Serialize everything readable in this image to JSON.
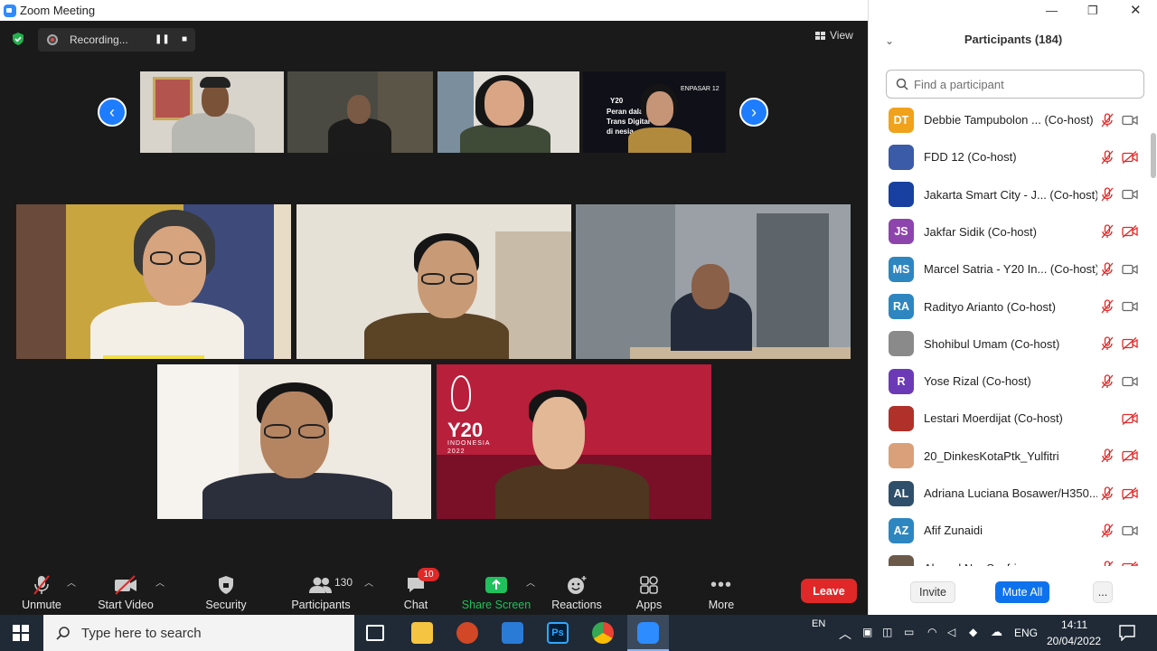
{
  "window": {
    "title": "Zoom Meeting"
  },
  "stage": {
    "recording_label": "Recording...",
    "view_label": "View"
  },
  "toolbar": {
    "unmute": "Unmute",
    "start_video": "Start Video",
    "security": "Security",
    "participants": "Participants",
    "participants_count": "130",
    "chat": "Chat",
    "chat_badge": "10",
    "share_screen": "Share Screen",
    "reactions": "Reactions",
    "apps": "Apps",
    "more": "More",
    "leave": "Leave"
  },
  "panel": {
    "title": "Participants (184)",
    "search_placeholder": "Find a participant",
    "invite": "Invite",
    "mute_all": "Mute All",
    "more": "...",
    "participants": [
      {
        "initials": "DT",
        "name": "Debbie Tampubolon ...  (Co-host)",
        "color": "#f0a21c",
        "mic_muted": true,
        "cam_off": false
      },
      {
        "initials": "",
        "name": "FDD 12 (Co-host)",
        "color": "#3b5aa8",
        "mic_muted": true,
        "cam_off": true
      },
      {
        "initials": "",
        "name": "Jakarta Smart City - J...  (Co-host)",
        "color": "#1740a0",
        "mic_muted": true,
        "cam_off": false
      },
      {
        "initials": "JS",
        "name": "Jakfar Sidik (Co-host)",
        "color": "#8e44ad",
        "mic_muted": true,
        "cam_off": true
      },
      {
        "initials": "MS",
        "name": "Marcel Satria - Y20 In...  (Co-host)",
        "color": "#2e86c1",
        "mic_muted": true,
        "cam_off": false
      },
      {
        "initials": "RA",
        "name": "Radityo Arianto (Co-host)",
        "color": "#2e86c1",
        "mic_muted": true,
        "cam_off": false
      },
      {
        "initials": "",
        "name": "Shohibul Umam (Co-host)",
        "color": "#8a8a8a",
        "mic_muted": true,
        "cam_off": true
      },
      {
        "initials": "R",
        "name": "Yose Rizal (Co-host)",
        "color": "#6c3ab7",
        "mic_muted": true,
        "cam_off": false
      },
      {
        "initials": "",
        "name": "Lestari Moerdijat (Co-host)",
        "color": "#b0302a",
        "mic_muted": false,
        "cam_off": true
      },
      {
        "initials": "",
        "name": "20_DinkesKotaPtk_Yulfitri",
        "color": "#d9a07a",
        "mic_muted": true,
        "cam_off": true
      },
      {
        "initials": "AL",
        "name": "Adriana Luciana Bosawer/H350...",
        "color": "#2f4f6a",
        "mic_muted": true,
        "cam_off": true
      },
      {
        "initials": "AZ",
        "name": "Afif Zunaidi",
        "color": "#2e86c1",
        "mic_muted": true,
        "cam_off": false
      },
      {
        "initials": "",
        "name": "Ahmad Nur Syafri",
        "color": "#6b5a4a",
        "mic_muted": true,
        "cam_off": true
      }
    ]
  },
  "taskbar": {
    "search_placeholder": "Type here to search",
    "lang_top": "EN",
    "lang": "ENG",
    "time": "14:11",
    "date": "20/04/2022"
  },
  "tiles": {
    "y20_logo_text": "Y20",
    "y20_logo_sub": "INDONESIA",
    "y20_logo_year": "2022",
    "thumb4_text_1": "Y20",
    "thumb4_text_2": "ENPASAR 12",
    "thumb4_text_3": "Peran        dalam",
    "thumb4_text_4": "Trans       Digital",
    "thumb4_text_5": "di      nesia"
  },
  "colors": {
    "accent": "#2d8cff",
    "leave": "#e02828",
    "share": "#20c05c"
  }
}
